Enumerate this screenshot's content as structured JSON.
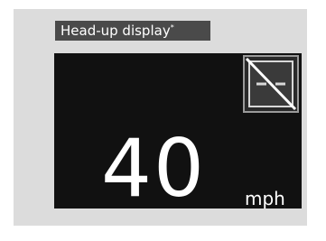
{
  "header": {
    "title": "Head-up display",
    "footnote_mark": "*"
  },
  "display": {
    "speed": "40",
    "unit": "mph",
    "indicator_icon": "lane-keeping-off-icon"
  },
  "colors": {
    "panel_bg": "#dcdcdc",
    "header_bg": "#4a4a4a",
    "display_bg": "#111111",
    "text": "#ffffff"
  }
}
